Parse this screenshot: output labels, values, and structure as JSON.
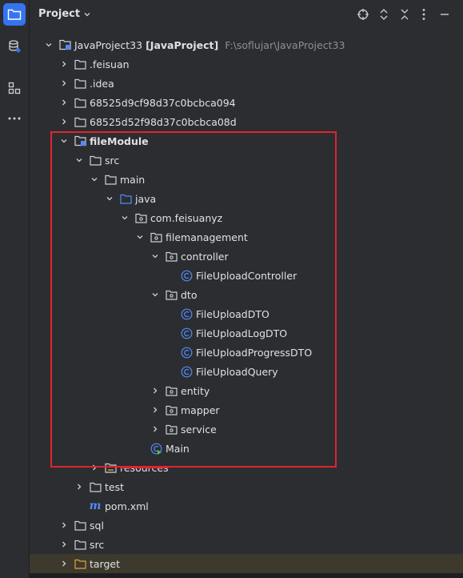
{
  "header": {
    "title": "Project"
  },
  "tree": [
    {
      "depth": 0,
      "arrow": "down",
      "icon": "module",
      "label": "JavaProject33",
      "extra": "[JavaProject]",
      "path": "F:\\soflujar\\JavaProject33",
      "bold": false
    },
    {
      "depth": 1,
      "arrow": "right",
      "icon": "folder",
      "label": ".feisuan"
    },
    {
      "depth": 1,
      "arrow": "right",
      "icon": "folder",
      "label": ".idea"
    },
    {
      "depth": 1,
      "arrow": "right",
      "icon": "folder",
      "label": "68525d9cf98d37c0bcbca094"
    },
    {
      "depth": 1,
      "arrow": "right",
      "icon": "folder",
      "label": "68525d52f98d37c0bcbca08d"
    },
    {
      "depth": 1,
      "arrow": "down",
      "icon": "module",
      "label": "fileModule",
      "bold": true
    },
    {
      "depth": 2,
      "arrow": "down",
      "icon": "folder",
      "label": "src"
    },
    {
      "depth": 3,
      "arrow": "down",
      "icon": "folder",
      "label": "main"
    },
    {
      "depth": 4,
      "arrow": "down",
      "icon": "source-folder",
      "label": "java"
    },
    {
      "depth": 5,
      "arrow": "down",
      "icon": "package",
      "label": "com.feisuanyz"
    },
    {
      "depth": 6,
      "arrow": "down",
      "icon": "package",
      "label": "filemanagement"
    },
    {
      "depth": 7,
      "arrow": "down",
      "icon": "package",
      "label": "controller"
    },
    {
      "depth": 8,
      "arrow": "none",
      "icon": "class",
      "label": "FileUploadController"
    },
    {
      "depth": 7,
      "arrow": "down",
      "icon": "package",
      "label": "dto"
    },
    {
      "depth": 8,
      "arrow": "none",
      "icon": "class",
      "label": "FileUploadDTO"
    },
    {
      "depth": 8,
      "arrow": "none",
      "icon": "class",
      "label": "FileUploadLogDTO"
    },
    {
      "depth": 8,
      "arrow": "none",
      "icon": "class",
      "label": "FileUploadProgressDTO"
    },
    {
      "depth": 8,
      "arrow": "none",
      "icon": "class",
      "label": "FileUploadQuery"
    },
    {
      "depth": 7,
      "arrow": "right",
      "icon": "package",
      "label": "entity"
    },
    {
      "depth": 7,
      "arrow": "right",
      "icon": "package",
      "label": "mapper"
    },
    {
      "depth": 7,
      "arrow": "right",
      "icon": "package",
      "label": "service"
    },
    {
      "depth": 6,
      "arrow": "none",
      "icon": "main-class",
      "label": "Main"
    },
    {
      "depth": 3,
      "arrow": "right",
      "icon": "resources-folder",
      "label": "resources",
      "strike": true
    },
    {
      "depth": 2,
      "arrow": "right",
      "icon": "folder",
      "label": "test"
    },
    {
      "depth": 2,
      "arrow": "none",
      "icon": "maven",
      "label": "pom.xml"
    },
    {
      "depth": 1,
      "arrow": "right",
      "icon": "folder",
      "label": "sql"
    },
    {
      "depth": 1,
      "arrow": "right",
      "icon": "folder",
      "label": "src"
    },
    {
      "depth": 1,
      "arrow": "right",
      "icon": "target-folder",
      "label": "target",
      "highlight": true
    }
  ],
  "colors": {
    "accent": "#3574f0",
    "highlight_box": "#e0242f",
    "class_icon": "#548af7",
    "folder_orange": "#d9a343"
  }
}
